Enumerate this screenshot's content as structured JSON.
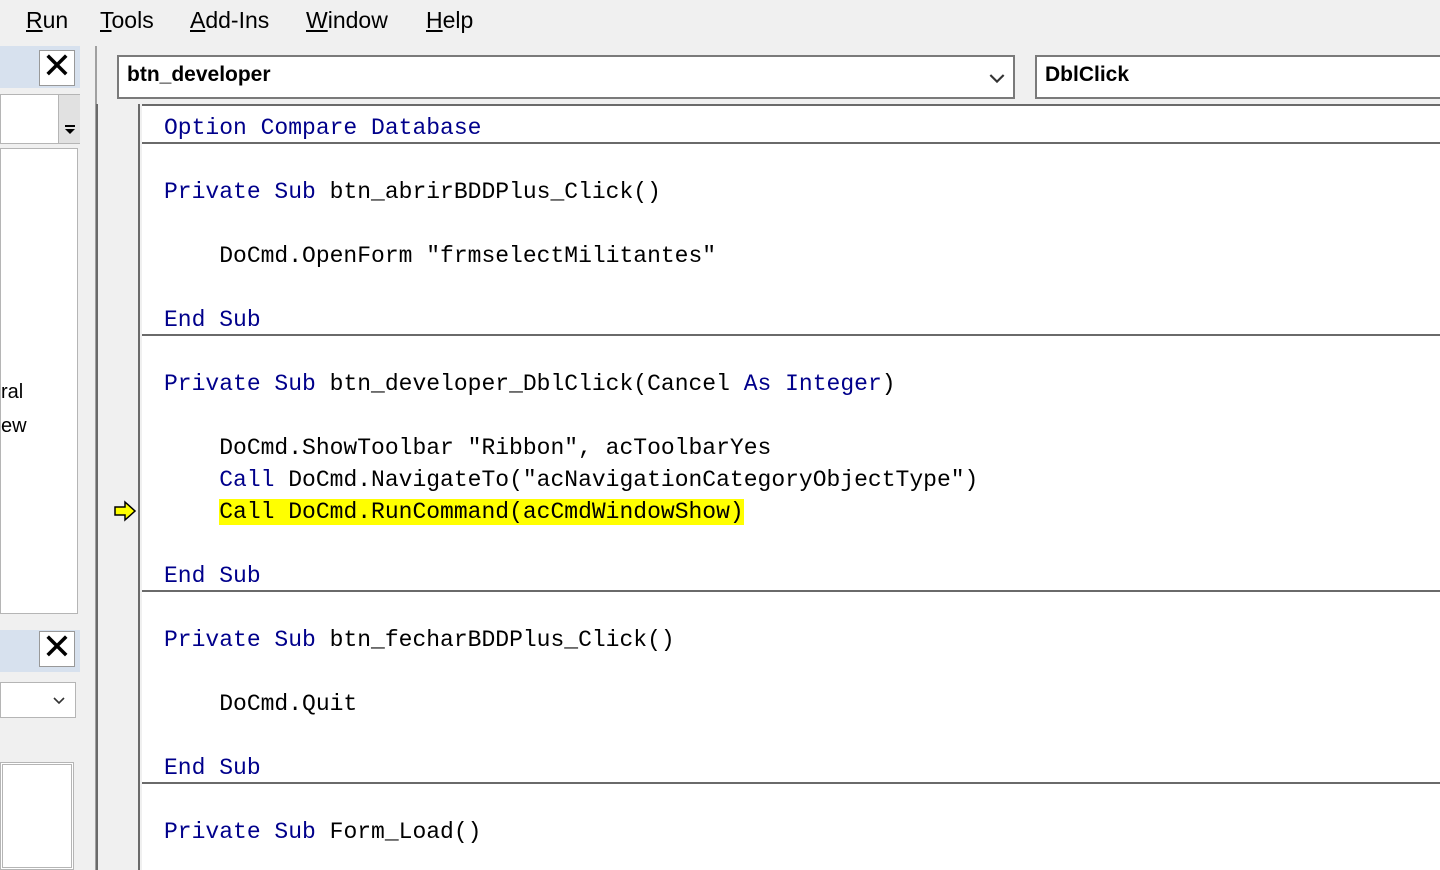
{
  "menubar": {
    "items": [
      {
        "accel": "R",
        "rest": "un"
      },
      {
        "accel": "T",
        "rest": "ools"
      },
      {
        "accel": "A",
        "rest": "dd-Ins"
      },
      {
        "accel": "W",
        "rest": "indow"
      },
      {
        "accel": "H",
        "rest": "elp"
      }
    ]
  },
  "left_panel": {
    "close_symbol": "✕",
    "tree_fragments": [
      "ral",
      "ew"
    ]
  },
  "object_combo": {
    "value": "btn_developer"
  },
  "procedure_combo": {
    "value": "DblClick"
  },
  "code": {
    "lines": [
      [
        {
          "t": "Option Compare Database",
          "kw": true
        }
      ],
      [
        {
          "t": "Private Sub ",
          "kw": true
        },
        {
          "t": "btn_abrirBDDPlus_Click()",
          "kw": false
        }
      ],
      [
        {
          "t": "    DoCmd.OpenForm \"frmselectMilitantes\"",
          "kw": false
        }
      ],
      [
        {
          "t": "End Sub",
          "kw": true
        }
      ],
      [
        {
          "t": "Private Sub ",
          "kw": true
        },
        {
          "t": "btn_developer_DblClick(Cancel ",
          "kw": false
        },
        {
          "t": "As Integer",
          "kw": true
        },
        {
          "t": ")",
          "kw": false
        }
      ],
      [
        {
          "t": "    DoCmd.ShowToolbar \"Ribbon\", acToolbarYes",
          "kw": false
        }
      ],
      [
        {
          "t": "    ",
          "kw": false
        },
        {
          "t": "Call ",
          "kw": true
        },
        {
          "t": "DoCmd.NavigateTo(\"acNavigationCategoryObjectType\")",
          "kw": false
        }
      ],
      [
        {
          "t": "    ",
          "kw": false
        },
        {
          "t": "Call DoCmd.RunCommand(acCmdWindowShow)",
          "kw": false,
          "hl": true
        }
      ],
      [
        {
          "t": "End Sub",
          "kw": true
        }
      ],
      [
        {
          "t": "Private Sub ",
          "kw": true
        },
        {
          "t": "btn_fecharBDDPlus_Click()",
          "kw": false
        }
      ],
      [
        {
          "t": "    DoCmd.Quit",
          "kw": false
        }
      ],
      [
        {
          "t": "End Sub",
          "kw": true
        }
      ],
      [
        {
          "t": "Private Sub ",
          "kw": true
        },
        {
          "t": "Form_Load()",
          "kw": false
        }
      ]
    ]
  },
  "colors": {
    "keyword": "#00008b",
    "highlight": "#ffff00",
    "execution_arrow": "#ffff00"
  }
}
